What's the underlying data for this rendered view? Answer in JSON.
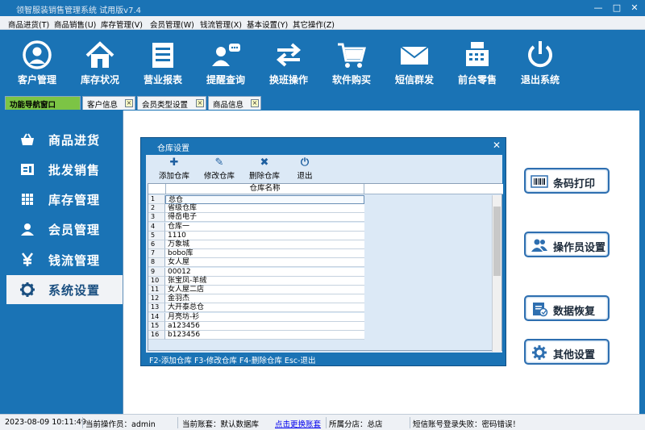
{
  "window": {
    "title": "领智服装销售管理系统 试用版v7.4",
    "controls": [
      "—",
      "□",
      "✕"
    ]
  },
  "menu": [
    {
      "label": "商品进货(T)"
    },
    {
      "label": "商品销售(U)"
    },
    {
      "label": "库存管理(V)"
    },
    {
      "label": "会员管理(W)"
    },
    {
      "label": "钱流管理(X)"
    },
    {
      "label": "基本设置(Y)"
    },
    {
      "label": "其它操作(Z)"
    }
  ],
  "toolbar": [
    {
      "label": "客户管理",
      "icon": "user-circle-icon"
    },
    {
      "label": "库存状况",
      "icon": "house-icon"
    },
    {
      "label": "营业报表",
      "icon": "report-list-icon"
    },
    {
      "label": "提醒查询",
      "icon": "user-chat-icon"
    },
    {
      "label": "换班操作",
      "icon": "swap-arrows-icon"
    },
    {
      "label": "软件购买",
      "icon": "shopping-cart-icon"
    },
    {
      "label": "短信群发",
      "icon": "envelope-icon"
    },
    {
      "label": "前台零售",
      "icon": "cash-register-icon"
    },
    {
      "label": "退出系统",
      "icon": "power-icon"
    }
  ],
  "tabs": [
    {
      "label": "功能导航窗口"
    },
    {
      "label": "客户信息"
    },
    {
      "label": "会员类型设置"
    },
    {
      "label": "商品信息"
    }
  ],
  "nav": [
    {
      "label": "商品进货",
      "icon": "basket-icon"
    },
    {
      "label": "批发销售",
      "icon": "invoice-icon"
    },
    {
      "label": "库存管理",
      "icon": "grid-icon"
    },
    {
      "label": "会员管理",
      "icon": "person-icon"
    },
    {
      "label": "钱流管理",
      "icon": "yen-icon"
    },
    {
      "label": "系统设置",
      "icon": "gear-icon",
      "active": true
    }
  ],
  "right_buttons": [
    {
      "label": "条码打印",
      "icon": "barcode-icon"
    },
    {
      "label": "操作员设置",
      "icon": "users-icon"
    },
    {
      "label": "数据恢复",
      "icon": "restore-icon"
    },
    {
      "label": "其他设置",
      "icon": "gear-icon"
    }
  ],
  "dialog": {
    "title": "仓库设置",
    "close": "✕",
    "buttons": [
      {
        "label": "添加仓库",
        "glyph": "✚",
        "icon": "plus-icon"
      },
      {
        "label": "修改仓库",
        "glyph": "✎",
        "icon": "pencil-icon"
      },
      {
        "label": "删除仓库",
        "glyph": "✖",
        "icon": "delete-x-icon"
      },
      {
        "label": "退出",
        "glyph": "⏻",
        "icon": "power-icon"
      }
    ],
    "column_header": "仓库名称",
    "rows": [
      {
        "n": "1",
        "name": "总仓",
        "selected": true
      },
      {
        "n": "2",
        "name": "省级仓库"
      },
      {
        "n": "3",
        "name": "得岳电子"
      },
      {
        "n": "4",
        "name": "仓库一"
      },
      {
        "n": "5",
        "name": "1110"
      },
      {
        "n": "6",
        "name": "万象城"
      },
      {
        "n": "7",
        "name": "bobo库"
      },
      {
        "n": "8",
        "name": "女人屋"
      },
      {
        "n": "9",
        "name": "00012"
      },
      {
        "n": "10",
        "name": "张宝凤-羊绒"
      },
      {
        "n": "11",
        "name": "女人屋二店"
      },
      {
        "n": "12",
        "name": "金羽杰"
      },
      {
        "n": "13",
        "name": "大开泰总仓"
      },
      {
        "n": "14",
        "name": "月亮坊-衫"
      },
      {
        "n": "15",
        "name": "a123456"
      },
      {
        "n": "16",
        "name": "b123456"
      }
    ],
    "status": "F2-添加仓库 F3-修改仓库 F4-删除仓库 Esc-退出"
  },
  "statusbar": {
    "datetime": "2023-08-09 10:11:49",
    "operator": "当前操作员：admin",
    "account": "当前账套：默认数据库",
    "switch_link": "点击更换账套",
    "branch": "所属分店：总店",
    "sms": "短信账号登录失败：密码错误！"
  },
  "colors": {
    "primary": "#1a73b5",
    "tab_active": "#7cc445",
    "dialog_bg": "#dce9f6"
  }
}
